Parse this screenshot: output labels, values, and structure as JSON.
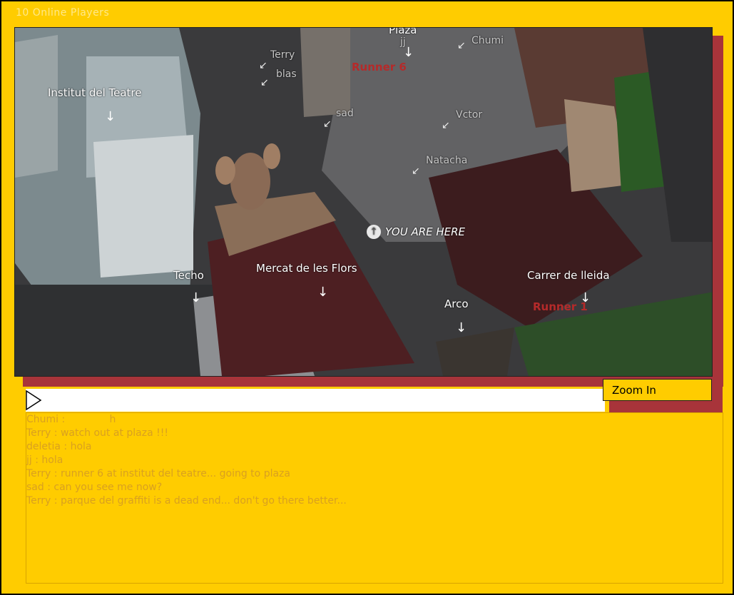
{
  "header": {
    "players": "10 Online Players"
  },
  "map": {
    "you_are_here": "YOU ARE HERE",
    "labels": {
      "plaza": "Plaza",
      "chumi": "Chumi",
      "terry": "Terry",
      "blas": "blas",
      "institut": "Institut del Teatre",
      "sad": "sad",
      "victor": "Vctor",
      "natacha": "Natacha",
      "techo": "Techo",
      "mercat": "Mercat de les Flors",
      "arco": "Arco",
      "carrer": "Carrer de lleida",
      "runner1": "Runner 1",
      "runner6": "Runner 6",
      "jj": "jj"
    }
  },
  "controls": {
    "zoom_label": "Zoom In",
    "input_value": ""
  },
  "chat": {
    "messages": [
      "Chumi :              h",
      "Terry : watch out at plaza !!!",
      "deletia : hola",
      "jj : hola",
      "Terry : runner 6 at institut del teatre... going to plaza",
      "sad : can you see me now?",
      "Terry : parque del graffiti is a dead end... don't go there better..."
    ]
  }
}
